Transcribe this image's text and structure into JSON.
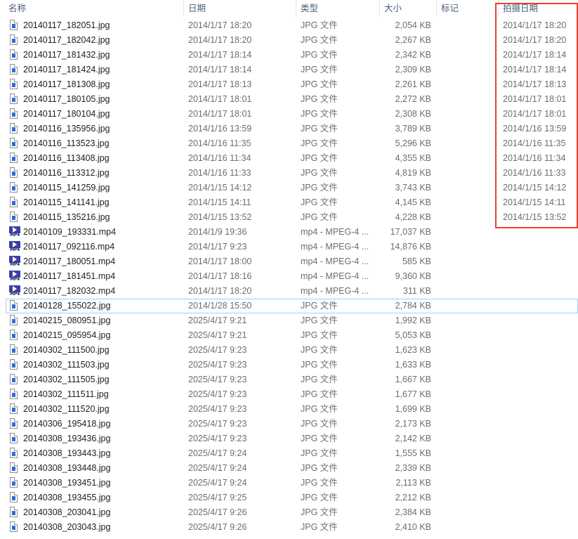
{
  "columns": {
    "name": "名称",
    "date": "日期",
    "type": "类型",
    "size": "大小",
    "tags": "标记",
    "date_taken": "拍摄日期"
  },
  "colors": {
    "highlight": "#e8432e",
    "focus_border": "#99d1ff",
    "header_text": "#4c607a",
    "jpg_icon_accent": "#2a6fd6",
    "mp4_icon_bg": "#3a3fa8"
  },
  "files": [
    {
      "icon": "jpg-file-icon",
      "name": "20140117_182051.jpg",
      "date": "2014/1/17 18:20",
      "type": "JPG 文件",
      "size": "2,054 KB",
      "taken": "2014/1/17 18:20"
    },
    {
      "icon": "jpg-file-icon",
      "name": "20140117_182042.jpg",
      "date": "2014/1/17 18:20",
      "type": "JPG 文件",
      "size": "2,267 KB",
      "taken": "2014/1/17 18:20"
    },
    {
      "icon": "jpg-file-icon",
      "name": "20140117_181432.jpg",
      "date": "2014/1/17 18:14",
      "type": "JPG 文件",
      "size": "2,342 KB",
      "taken": "2014/1/17 18:14"
    },
    {
      "icon": "jpg-file-icon",
      "name": "20140117_181424.jpg",
      "date": "2014/1/17 18:14",
      "type": "JPG 文件",
      "size": "2,309 KB",
      "taken": "2014/1/17 18:14"
    },
    {
      "icon": "jpg-file-icon",
      "name": "20140117_181308.jpg",
      "date": "2014/1/17 18:13",
      "type": "JPG 文件",
      "size": "2,261 KB",
      "taken": "2014/1/17 18:13"
    },
    {
      "icon": "jpg-file-icon",
      "name": "20140117_180105.jpg",
      "date": "2014/1/17 18:01",
      "type": "JPG 文件",
      "size": "2,272 KB",
      "taken": "2014/1/17 18:01"
    },
    {
      "icon": "jpg-file-icon",
      "name": "20140117_180104.jpg",
      "date": "2014/1/17 18:01",
      "type": "JPG 文件",
      "size": "2,308 KB",
      "taken": "2014/1/17 18:01"
    },
    {
      "icon": "jpg-file-icon",
      "name": "20140116_135956.jpg",
      "date": "2014/1/16 13:59",
      "type": "JPG 文件",
      "size": "3,789 KB",
      "taken": "2014/1/16 13:59"
    },
    {
      "icon": "jpg-file-icon",
      "name": "20140116_113523.jpg",
      "date": "2014/1/16 11:35",
      "type": "JPG 文件",
      "size": "5,296 KB",
      "taken": "2014/1/16 11:35"
    },
    {
      "icon": "jpg-file-icon",
      "name": "20140116_113408.jpg",
      "date": "2014/1/16 11:34",
      "type": "JPG 文件",
      "size": "4,355 KB",
      "taken": "2014/1/16 11:34"
    },
    {
      "icon": "jpg-file-icon",
      "name": "20140116_113312.jpg",
      "date": "2014/1/16 11:33",
      "type": "JPG 文件",
      "size": "4,819 KB",
      "taken": "2014/1/16 11:33"
    },
    {
      "icon": "jpg-file-icon",
      "name": "20140115_141259.jpg",
      "date": "2014/1/15 14:12",
      "type": "JPG 文件",
      "size": "3,743 KB",
      "taken": "2014/1/15 14:12"
    },
    {
      "icon": "jpg-file-icon",
      "name": "20140115_141141.jpg",
      "date": "2014/1/15 14:11",
      "type": "JPG 文件",
      "size": "4,145 KB",
      "taken": "2014/1/15 14:11"
    },
    {
      "icon": "jpg-file-icon",
      "name": "20140115_135216.jpg",
      "date": "2014/1/15 13:52",
      "type": "JPG 文件",
      "size": "4,228 KB",
      "taken": "2014/1/15 13:52"
    },
    {
      "icon": "mp4-file-icon",
      "name": "20140109_193331.mp4",
      "date": "2014/1/9 19:36",
      "type": "mp4 - MPEG-4 ...",
      "size": "17,037 KB",
      "taken": ""
    },
    {
      "icon": "mp4-file-icon",
      "name": "20140117_092116.mp4",
      "date": "2014/1/17 9:23",
      "type": "mp4 - MPEG-4 ...",
      "size": "14,876 KB",
      "taken": ""
    },
    {
      "icon": "mp4-file-icon",
      "name": "20140117_180051.mp4",
      "date": "2014/1/17 18:00",
      "type": "mp4 - MPEG-4 ...",
      "size": "585 KB",
      "taken": ""
    },
    {
      "icon": "mp4-file-icon",
      "name": "20140117_181451.mp4",
      "date": "2014/1/17 18:16",
      "type": "mp4 - MPEG-4 ...",
      "size": "9,360 KB",
      "taken": ""
    },
    {
      "icon": "mp4-file-icon",
      "name": "20140117_182032.mp4",
      "date": "2014/1/17 18:20",
      "type": "mp4 - MPEG-4 ...",
      "size": "311 KB",
      "taken": ""
    },
    {
      "icon": "jpg-file-icon",
      "name": "20140128_155022.jpg",
      "date": "2014/1/28 15:50",
      "type": "JPG 文件",
      "size": "2,784 KB",
      "taken": "",
      "focused": true
    },
    {
      "icon": "jpg-file-icon",
      "name": "20140215_080951.jpg",
      "date": "2025/4/17 9:21",
      "type": "JPG 文件",
      "size": "1,992 KB",
      "taken": ""
    },
    {
      "icon": "jpg-file-icon",
      "name": "20140215_095954.jpg",
      "date": "2025/4/17 9:21",
      "type": "JPG 文件",
      "size": "5,053 KB",
      "taken": ""
    },
    {
      "icon": "jpg-file-icon",
      "name": "20140302_111500.jpg",
      "date": "2025/4/17 9:23",
      "type": "JPG 文件",
      "size": "1,623 KB",
      "taken": ""
    },
    {
      "icon": "jpg-file-icon",
      "name": "20140302_111503.jpg",
      "date": "2025/4/17 9:23",
      "type": "JPG 文件",
      "size": "1,633 KB",
      "taken": ""
    },
    {
      "icon": "jpg-file-icon",
      "name": "20140302_111505.jpg",
      "date": "2025/4/17 9:23",
      "type": "JPG 文件",
      "size": "1,667 KB",
      "taken": ""
    },
    {
      "icon": "jpg-file-icon",
      "name": "20140302_111511.jpg",
      "date": "2025/4/17 9:23",
      "type": "JPG 文件",
      "size": "1,677 KB",
      "taken": ""
    },
    {
      "icon": "jpg-file-icon",
      "name": "20140302_111520.jpg",
      "date": "2025/4/17 9:23",
      "type": "JPG 文件",
      "size": "1,699 KB",
      "taken": ""
    },
    {
      "icon": "jpg-file-icon",
      "name": "20140306_195418.jpg",
      "date": "2025/4/17 9:23",
      "type": "JPG 文件",
      "size": "2,173 KB",
      "taken": ""
    },
    {
      "icon": "jpg-file-icon",
      "name": "20140308_193436.jpg",
      "date": "2025/4/17 9:23",
      "type": "JPG 文件",
      "size": "2,142 KB",
      "taken": ""
    },
    {
      "icon": "jpg-file-icon",
      "name": "20140308_193443.jpg",
      "date": "2025/4/17 9:24",
      "type": "JPG 文件",
      "size": "1,555 KB",
      "taken": ""
    },
    {
      "icon": "jpg-file-icon",
      "name": "20140308_193448.jpg",
      "date": "2025/4/17 9:24",
      "type": "JPG 文件",
      "size": "2,339 KB",
      "taken": ""
    },
    {
      "icon": "jpg-file-icon",
      "name": "20140308_193451.jpg",
      "date": "2025/4/17 9:24",
      "type": "JPG 文件",
      "size": "2,113 KB",
      "taken": ""
    },
    {
      "icon": "jpg-file-icon",
      "name": "20140308_193455.jpg",
      "date": "2025/4/17 9:25",
      "type": "JPG 文件",
      "size": "2,212 KB",
      "taken": ""
    },
    {
      "icon": "jpg-file-icon",
      "name": "20140308_203041.jpg",
      "date": "2025/4/17 9:26",
      "type": "JPG 文件",
      "size": "2,384 KB",
      "taken": ""
    },
    {
      "icon": "jpg-file-icon",
      "name": "20140308_203043.jpg",
      "date": "2025/4/17 9:26",
      "type": "JPG 文件",
      "size": "2,410 KB",
      "taken": ""
    }
  ]
}
